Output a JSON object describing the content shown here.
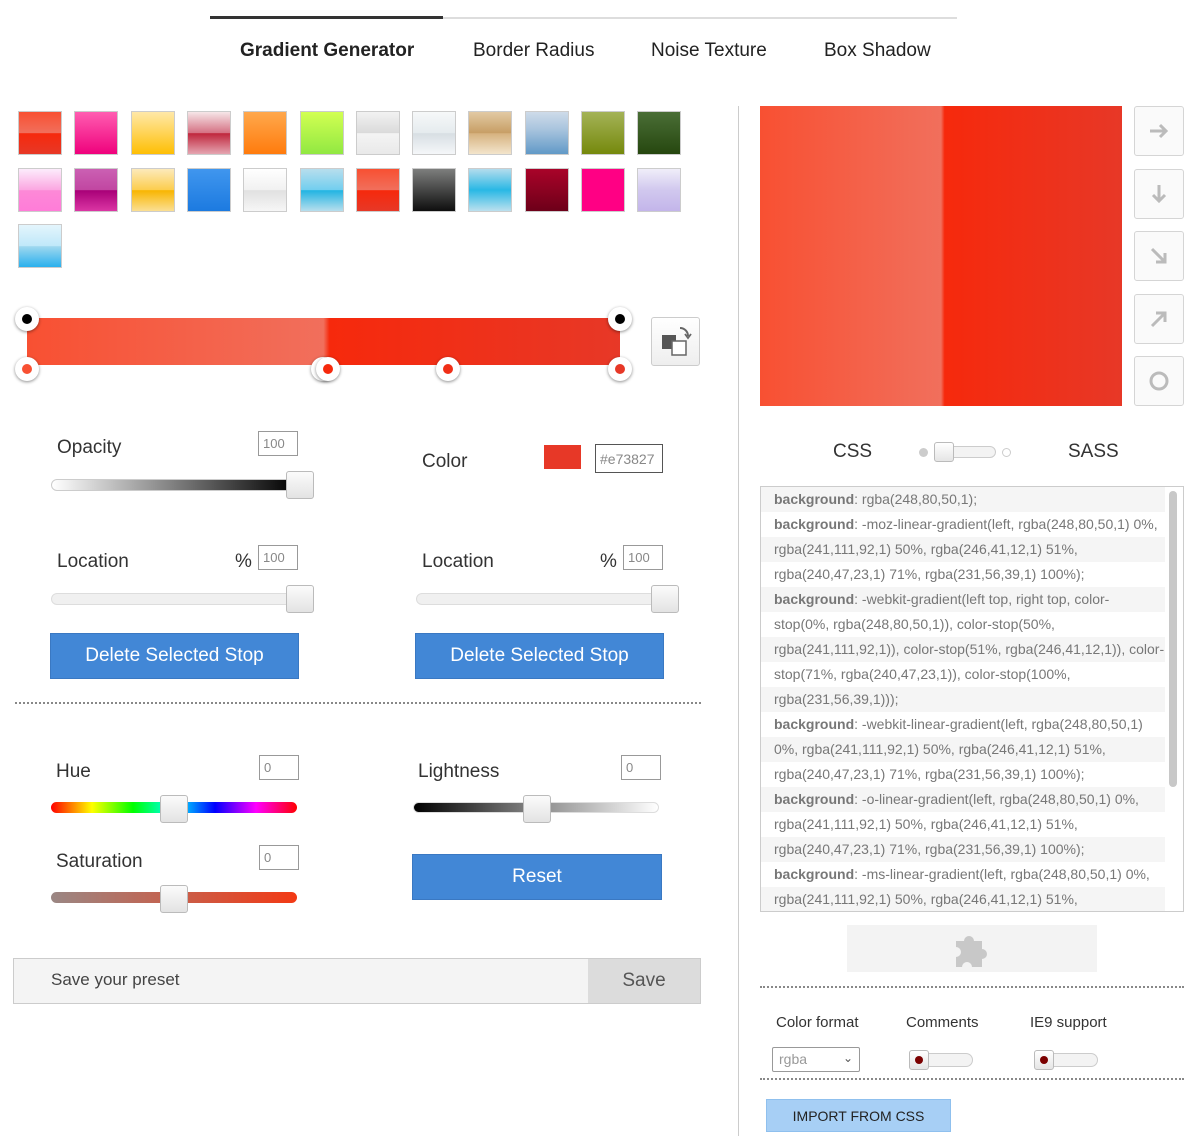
{
  "tabs": [
    {
      "label": "Gradient Generator",
      "active": true
    },
    {
      "label": "Border Radius",
      "active": false
    },
    {
      "label": "Noise Texture",
      "active": false
    },
    {
      "label": "Box Shadow",
      "active": false
    }
  ],
  "presets": [
    "linear-gradient(#f85032 0%, #f16f5c 50%, #f6290c 51%, #f02f17 71%, #e73827 100%)",
    "linear-gradient(#ff5db1 0%, #ef017c 100%)",
    "linear-gradient(#ffe8a8 0%, #ffd65e 45%, #febf04 100%)",
    "linear-gradient(#f6e6e8 0%, #d57183 50%, #bf263c 51%, #e5a5b1 100%)",
    "linear-gradient(#ffa84c 0%, #ff7b0d 100%)",
    "linear-gradient(#d2ff52 0%, #91e842 100%)",
    "linear-gradient(#f2f2f2 0%, #dadada 50%, #f4f4f4 51%, #e9e9e9 100%)",
    "linear-gradient(#f6f8f9 0%, #e5ebee 50%, #d7dee3 51%, #f5f7f9 100%)",
    "linear-gradient(#e2c9a3 0%, #c79e65 50%, #d6b27f 51%, #f3e5cc 100%)",
    "linear-gradient(#cedbe9 0%, #aac5de 40%, #6199c7 100%)",
    "linear-gradient(#a4b357 0%, #75890c 100%)",
    "linear-gradient(#4a6e36 0%, #26470f 100%)",
    "linear-gradient(#fcecfc 0%, #fba6e1 50%, #fd89d7 51%, #ff7cd8 100%)",
    "linear-gradient(#cb60b3 0%, #c146a1 50%, #a80077 51%, #db36a4 100%)",
    "linear-gradient(#fceabb 0%, #fccd4d 50%, #f8b500 51%, #fbdf93 100%)",
    "linear-gradient(#4096ee 0%, #1c7ae0 100%)",
    "linear-gradient(#ffffff 0%, #f1f1f1 50%, #e1e1e1 51%, #f6f6f6 100%)",
    "linear-gradient(#b7deed 0%, #71ceef 50%, #21b4e2 51%, #b7deed 100%)",
    "linear-gradient(#f85032 0%, #f16f5c 50%, #f6290c 51%, #f02f17 71%, #e73827 100%)",
    "linear-gradient(#7d7e7d 0%, #0e0e0e 100%)",
    "linear-gradient(#b3dced 0%, #29b8e5 50%, #bce0ee 100%)",
    "linear-gradient(#a90329 0%, #8f0222 44%, #6d0019 100%)",
    "linear-gradient(#ff0084 0%, #ff0084 100%)",
    "linear-gradient(#f0eef9 0%, #d1c8ee 50%, #c3b5ea 100%)",
    "linear-gradient(#e4f5fc 0%, #bfe8f9 50%, #9fd8ef 51%, #2ab0ed 100%)"
  ],
  "gradient": {
    "css": "linear-gradient(to right, #f85032 0%, #f16f5c 50%, #f6290c 51%, #f02f17 71%, #e73827 100%)",
    "opacity_stops": [
      0,
      100
    ],
    "color_stops": [
      {
        "location": 0,
        "color": "#f85032"
      },
      {
        "location": 50,
        "color": "#f16f5c"
      },
      {
        "location": 51,
        "color": "#f6290c"
      },
      {
        "location": 71,
        "color": "#f02f17"
      },
      {
        "location": 100,
        "color": "#e73827"
      }
    ]
  },
  "opacity": {
    "label": "Opacity",
    "value": "100"
  },
  "color": {
    "label": "Color",
    "swatch": "#e73827",
    "hex": "#e73827"
  },
  "location_left": {
    "label": "Location",
    "unit": "%",
    "value": "100"
  },
  "location_right": {
    "label": "Location",
    "unit": "%",
    "value": "100"
  },
  "delete_left": "Delete Selected Stop",
  "delete_right": "Delete Selected Stop",
  "hue": {
    "label": "Hue",
    "value": "0"
  },
  "lightness": {
    "label": "Lightness",
    "value": "0"
  },
  "saturation": {
    "label": "Saturation",
    "value": "0"
  },
  "reset": "Reset",
  "preset": {
    "placeholder": "Save your preset",
    "save": "Save"
  },
  "preview": {
    "css": "linear-gradient(to right, #f85032 0%, #f16f5c 50%, #f6290c 51%, #f02f17 71%, #e73827 100%)"
  },
  "direction_buttons": [
    "arrow-right-icon",
    "arrow-down-icon",
    "arrow-down-right-icon",
    "arrow-up-right-icon",
    "circle-icon"
  ],
  "output_mode": {
    "left": "CSS",
    "right": "SASS"
  },
  "code_lines": [
    {
      "prop": "background",
      "text": ": rgba(248,80,50,1);"
    },
    {
      "prop": "background",
      "text": ": -moz-linear-gradient(left, rgba(248,80,50,1) 0%,"
    },
    {
      "prop": "",
      "text": "rgba(241,111,92,1) 50%, rgba(246,41,12,1) 51%,"
    },
    {
      "prop": "",
      "text": "rgba(240,47,23,1) 71%, rgba(231,56,39,1) 100%);"
    },
    {
      "prop": "background",
      "text": ": -webkit-gradient(left top, right top, color-"
    },
    {
      "prop": "",
      "text": "stop(0%, rgba(248,80,50,1)), color-stop(50%,"
    },
    {
      "prop": "",
      "text": "rgba(241,111,92,1)), color-stop(51%, rgba(246,41,12,1)), color-"
    },
    {
      "prop": "",
      "text": "stop(71%, rgba(240,47,23,1)), color-stop(100%,"
    },
    {
      "prop": "",
      "text": "rgba(231,56,39,1)));"
    },
    {
      "prop": "background",
      "text": ": -webkit-linear-gradient(left, rgba(248,80,50,1)"
    },
    {
      "prop": "",
      "text": "0%, rgba(241,111,92,1) 50%, rgba(246,41,12,1) 51%,"
    },
    {
      "prop": "",
      "text": "rgba(240,47,23,1) 71%, rgba(231,56,39,1) 100%);"
    },
    {
      "prop": "background",
      "text": ": -o-linear-gradient(left, rgba(248,80,50,1) 0%,"
    },
    {
      "prop": "",
      "text": "rgba(241,111,92,1) 50%, rgba(246,41,12,1) 51%,"
    },
    {
      "prop": "",
      "text": "rgba(240,47,23,1) 71%, rgba(231,56,39,1) 100%);"
    },
    {
      "prop": "background",
      "text": ": -ms-linear-gradient(left, rgba(248,80,50,1) 0%,"
    },
    {
      "prop": "",
      "text": "rgba(241,111,92,1) 50%, rgba(246,41,12,1) 51%,"
    }
  ],
  "options": {
    "color_format": {
      "label": "Color format",
      "value": "rgba"
    },
    "comments": {
      "label": "Comments"
    },
    "ie9": {
      "label": "IE9 support"
    }
  },
  "import_button": "IMPORT FROM CSS",
  "ad_icon": "puzzle-icon"
}
